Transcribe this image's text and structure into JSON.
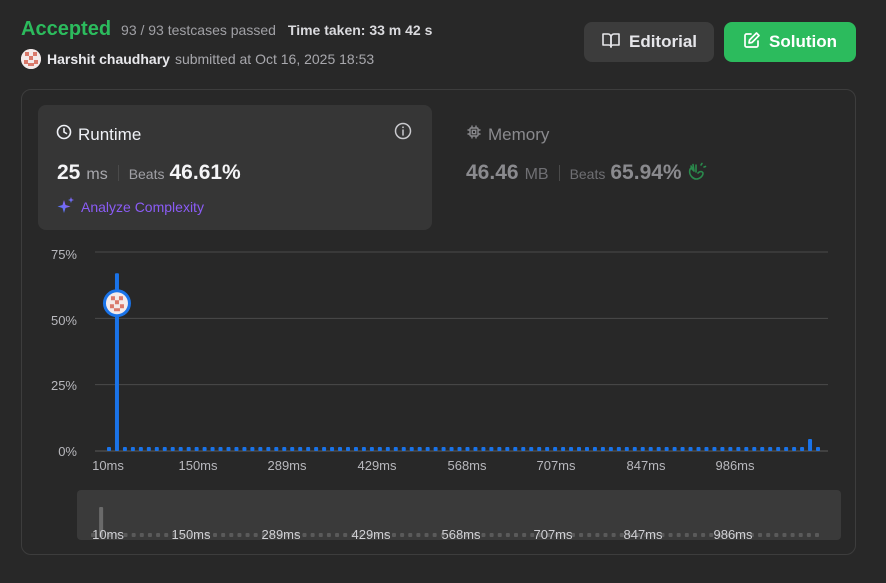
{
  "header": {
    "status": "Accepted",
    "testcases": "93 / 93 testcases passed",
    "time_taken": "Time taken: 33 m 42 s",
    "username": "Harshit chaudhary",
    "submitted_text": "submitted at Oct 16, 2025 18:53"
  },
  "buttons": {
    "editorial": "Editorial",
    "solution": "Solution"
  },
  "runtime": {
    "title": "Runtime",
    "value": "25",
    "unit": "ms",
    "beats_label": "Beats",
    "beats_value": "46.61%",
    "analyze": "Analyze Complexity"
  },
  "memory": {
    "title": "Memory",
    "value": "46.46",
    "unit": "MB",
    "beats_label": "Beats",
    "beats_value": "65.94%"
  },
  "colors": {
    "accepted": "#2cbb5d",
    "bar": "#1a73e8",
    "purple": "#8b5cf6"
  },
  "chart_data": {
    "type": "bar",
    "y_ticks": [
      "75%",
      "50%",
      "25%",
      "0%"
    ],
    "ylim": [
      0,
      75
    ],
    "x_ticks": [
      "10ms",
      "150ms",
      "289ms",
      "429ms",
      "568ms",
      "707ms",
      "847ms",
      "986ms"
    ],
    "navigator_ticks": [
      "10ms",
      "150ms",
      "289ms",
      "429ms",
      "568ms",
      "707ms",
      "847ms",
      "986ms"
    ],
    "highlight_index": 1,
    "values": [
      1.5,
      67,
      1.5,
      1.5,
      1.5,
      1.5,
      1.5,
      1.5,
      1.5,
      1.5,
      1.5,
      1.5,
      1.5,
      1.5,
      1.5,
      1.5,
      1.5,
      1.5,
      1.5,
      1.5,
      1.5,
      1.5,
      1.5,
      1.5,
      1.5,
      1.5,
      1.5,
      1.5,
      1.5,
      1.5,
      1.5,
      1.5,
      1.5,
      1.5,
      1.5,
      1.5,
      1.5,
      1.5,
      1.5,
      1.5,
      1.5,
      1.5,
      1.5,
      1.5,
      1.5,
      1.5,
      1.5,
      1.5,
      1.5,
      1.5,
      1.5,
      1.5,
      1.5,
      1.5,
      1.5,
      1.5,
      1.5,
      1.5,
      1.5,
      1.5,
      1.5,
      1.5,
      1.5,
      1.5,
      1.5,
      1.5,
      1.5,
      1.5,
      1.5,
      1.5,
      1.5,
      1.5,
      1.5,
      1.5,
      1.5,
      1.5,
      1.5,
      1.5,
      1.5,
      1.5,
      1.5,
      1.5,
      1.5,
      1.5,
      1.5,
      1.5,
      1.5,
      1.5,
      4.5,
      1.5
    ]
  }
}
